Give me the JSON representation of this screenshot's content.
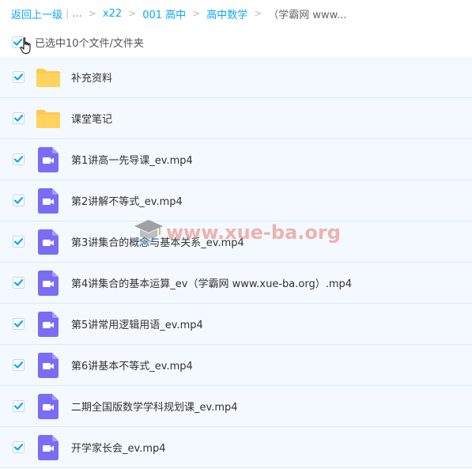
{
  "breadcrumb": {
    "back": "返回上一级",
    "separator_bar": "|",
    "ellipsis": "...",
    "separator": ">",
    "items": [
      "x22",
      "001 高中",
      "高中数学"
    ],
    "current": "（学霸网 www..."
  },
  "selection": {
    "label": "已选中10个文件/文件夹"
  },
  "files": [
    {
      "name": "补充资料",
      "type": "folder"
    },
    {
      "name": "课堂笔记",
      "type": "folder"
    },
    {
      "name": "第1讲高一先导课_ev.mp4",
      "type": "video"
    },
    {
      "name": "第2讲解不等式_ev.mp4",
      "type": "video"
    },
    {
      "name": "第3讲集合的概念与基本关系_ev.mp4",
      "type": "video"
    },
    {
      "name": "第4讲集合的基本运算_ev（学霸网 www.xue-ba.org）.mp4",
      "type": "video"
    },
    {
      "name": "第5讲常用逻辑用语_ev.mp4",
      "type": "video"
    },
    {
      "name": "第6讲基本不等式_ev.mp4",
      "type": "video"
    },
    {
      "name": "二期全国版数学学科规划课_ev.mp4",
      "type": "video"
    },
    {
      "name": "开学家长会_ev.mp4",
      "type": "video"
    }
  ],
  "watermark": {
    "text": "www.xue-ba.org"
  },
  "colors": {
    "accent": "#06a7ff",
    "checkbox": "#06a7ff",
    "folder": "#ffc94d",
    "video": "#7b6cf6",
    "row_bg": "#f3f9fe"
  },
  "icons": {
    "checkbox": "checkbox-checked-icon",
    "folder": "folder-icon",
    "video": "video-file-icon",
    "cursor": "hand-cursor-icon"
  }
}
